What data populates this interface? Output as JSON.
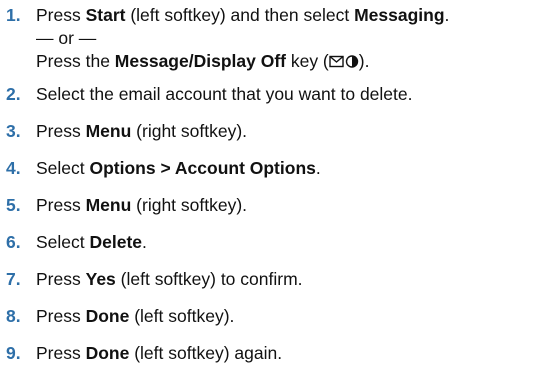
{
  "steps": [
    {
      "number": "1.",
      "parts": [
        "Press ",
        "Start",
        " (left softkey) and then select ",
        "Messaging",
        "."
      ],
      "alternative_separator": "— or —",
      "alternative": {
        "prefix": "Press the ",
        "key_name": "Message/Display Off",
        "mid": " key (",
        "icon": "envelope-moon-icon",
        "suffix": ")."
      }
    },
    {
      "number": "2.",
      "parts": [
        "Select the email account that you want to delete."
      ]
    },
    {
      "number": "3.",
      "parts": [
        "Press ",
        "Menu",
        " (right softkey)."
      ]
    },
    {
      "number": "4.",
      "parts": [
        "Select ",
        "Options > Account Options",
        "."
      ]
    },
    {
      "number": "5.",
      "parts": [
        "Press ",
        "Menu",
        " (right softkey)."
      ]
    },
    {
      "number": "6.",
      "parts": [
        "Select ",
        "Delete",
        "."
      ]
    },
    {
      "number": "7.",
      "parts": [
        "Press ",
        "Yes",
        " (left softkey) to confirm."
      ]
    },
    {
      "number": "8.",
      "parts": [
        "Press ",
        "Done",
        " (left softkey)."
      ]
    },
    {
      "number": "9.",
      "parts": [
        "Press ",
        "Done",
        " (left softkey) again."
      ]
    }
  ],
  "colors": {
    "step_number": "#2e6fa8",
    "text": "#111111",
    "background": "#ffffff"
  }
}
